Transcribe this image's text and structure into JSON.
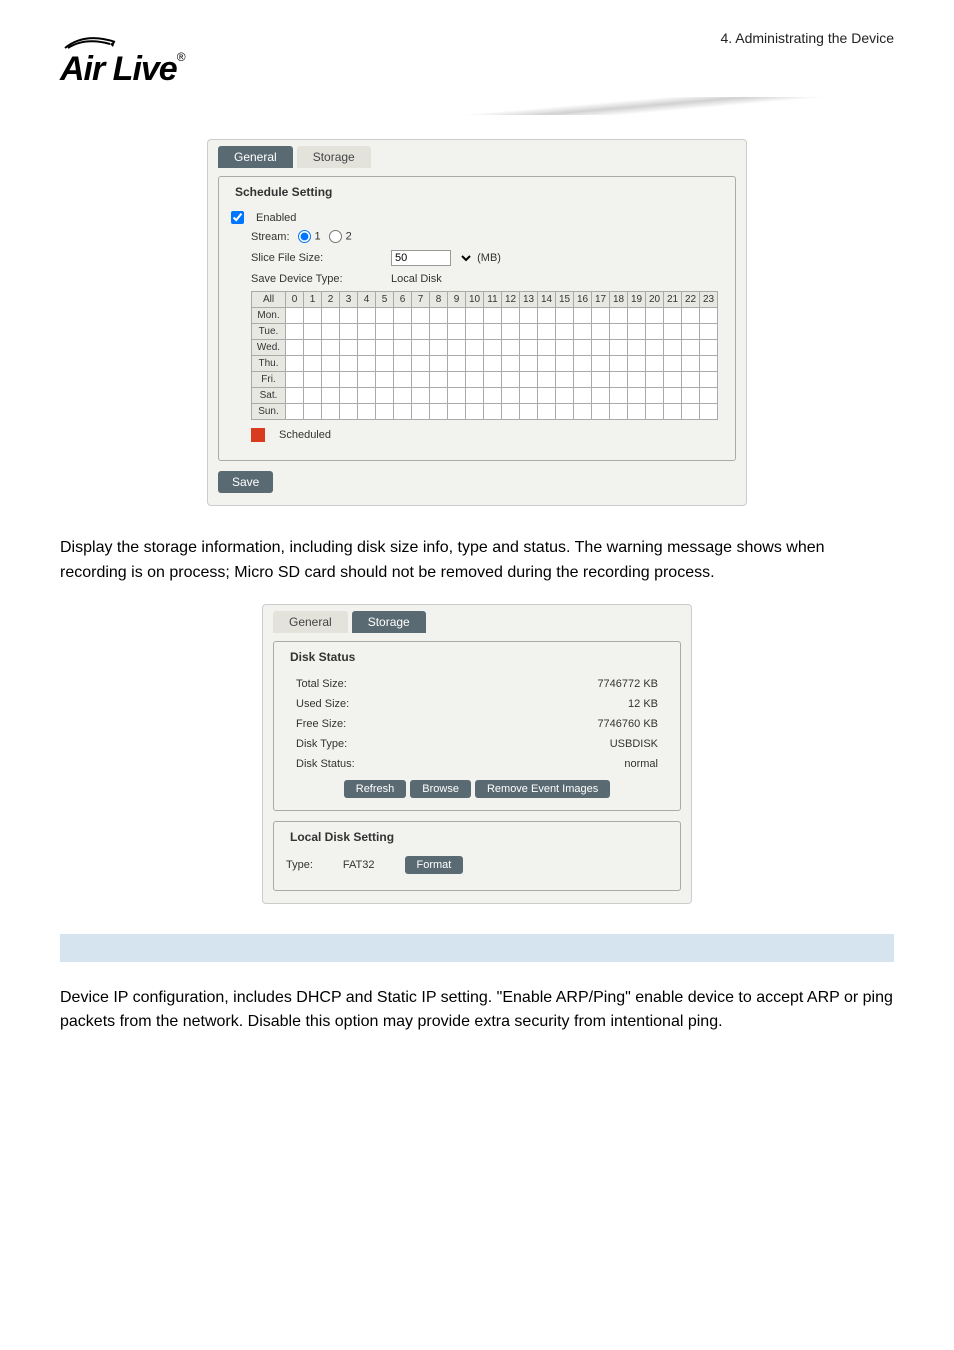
{
  "header": {
    "logo_top": "≋",
    "logo_text": "Air Live",
    "reg": "®",
    "chapter": "4. Administrating the Device"
  },
  "panel1": {
    "tab_general": "General",
    "tab_storage": "Storage",
    "legend": "Schedule Setting",
    "enabled_label": "Enabled",
    "stream_label": "Stream:",
    "stream_opt1": "1",
    "stream_opt2": "2",
    "slice_label": "Slice File Size:",
    "slice_value": "50",
    "slice_unit": "(MB)",
    "save_device_label": "Save Device Type:",
    "save_device_value": "Local Disk",
    "hours": [
      "All",
      "0",
      "1",
      "2",
      "3",
      "4",
      "5",
      "6",
      "7",
      "8",
      "9",
      "10",
      "11",
      "12",
      "13",
      "14",
      "15",
      "16",
      "17",
      "18",
      "19",
      "20",
      "21",
      "22",
      "23"
    ],
    "days": [
      "Mon.",
      "Tue.",
      "Wed.",
      "Thu.",
      "Fri.",
      "Sat.",
      "Sun."
    ],
    "scheduled_label": "Scheduled",
    "save_btn": "Save"
  },
  "para1": "Display the storage information, including disk size info, type and status.    The warning message shows when recording is on process; Micro SD card should not be removed during the recording process.",
  "panel2": {
    "tab_general": "General",
    "tab_storage": "Storage",
    "legend": "Disk Status",
    "total_size_label": "Total Size:",
    "total_size_value": "7746772 KB",
    "used_size_label": "Used Size:",
    "used_size_value": "12 KB",
    "free_size_label": "Free Size:",
    "free_size_value": "7746760 KB",
    "disk_type_label": "Disk Type:",
    "disk_type_value": "USBDISK",
    "disk_status_label": "Disk Status:",
    "disk_status_value": "normal",
    "refresh_btn": "Refresh",
    "browse_btn": "Browse",
    "remove_btn": "Remove Event Images",
    "local_legend": "Local Disk Setting",
    "type_label": "Type:",
    "type_value": "FAT32",
    "format_btn": "Format"
  },
  "para2": "Device IP configuration, includes DHCP and Static IP setting.    \"Enable ARP/Ping\" enable device to accept ARP or ping packets from the network.    Disable this option may provide extra security from intentional ping."
}
